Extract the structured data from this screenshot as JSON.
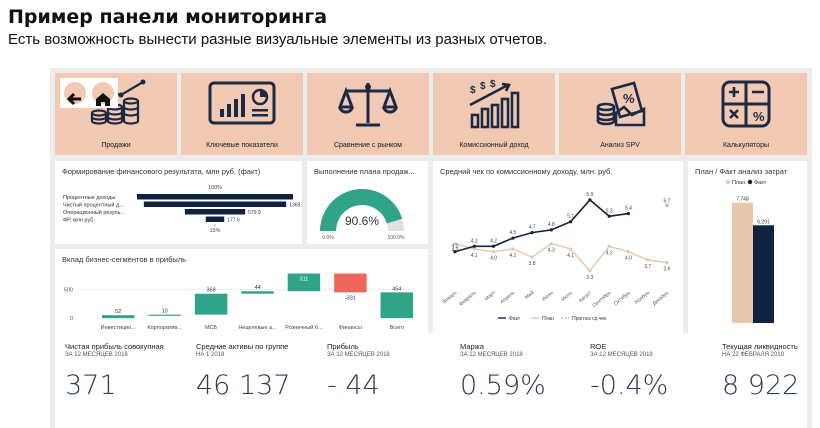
{
  "header": {
    "title": "Пример панели мониторинга",
    "subtitle": "Есть возможность вынести разные визуальные элементы из разных отчетов."
  },
  "nav": {
    "back_icon": "back-arrow-icon",
    "home_icon": "home-icon"
  },
  "tiles": [
    {
      "label": "Продажи",
      "icon": "sales-coins-icon"
    },
    {
      "label": "Ключевые показатели",
      "icon": "kpi-monitor-icon"
    },
    {
      "label": "Сравнение с рынком",
      "icon": "scales-icon"
    },
    {
      "label": "Комиссионный доход",
      "icon": "commission-chart-icon"
    },
    {
      "label": "Анализ SPV",
      "icon": "spv-percent-icon"
    },
    {
      "label": "Калькуляторы",
      "icon": "calculator-icon"
    }
  ],
  "colors": {
    "tile_bg": "#f2c9b3",
    "navy": "#0f2340",
    "teal": "#2fa489",
    "beige": "#e6c6ac",
    "red": "#f0675a",
    "value_text": "#2b3c55"
  },
  "chart_data": [
    {
      "type": "bar",
      "title": "Формирование финансового результата, млн руб. (факт)",
      "categories": [
        "Процентные доходы",
        "Чистый процентный д...",
        "Операционный резуль...",
        "ФР, млн руб."
      ],
      "values": [
        1500,
        1369.3,
        579.9,
        177.6
      ],
      "data_labels": [
        "",
        "1369.3",
        "579.9",
        "177.6"
      ],
      "top_label": "100%",
      "bottom_label": "15%"
    },
    {
      "type": "gauge",
      "title": "Выполнение плана продаж...",
      "value": 90.6,
      "display_value": "90.6%",
      "min_label": "0.0%",
      "max_label": "100.0%"
    },
    {
      "type": "line",
      "title": "Средний чек по комиссионному доходу, млн. руб.",
      "x": [
        "Январь",
        "Февраль",
        "Март",
        "Апрель",
        "Май",
        "Июнь",
        "Июль",
        "Август",
        "Сентябрь",
        "Октябрь",
        "Ноябрь",
        "Декабрь"
      ],
      "series": [
        {
          "name": "Факт",
          "values": [
            4.0,
            4.2,
            4.2,
            4.5,
            4.7,
            4.8,
            5.1,
            5.9,
            5.3,
            5.4,
            null,
            null
          ]
        },
        {
          "name": "План",
          "values": [
            4.3,
            4.1,
            4.0,
            4.1,
            3.8,
            4.3,
            4.1,
            3.3,
            4.2,
            4.0,
            3.7,
            3.6
          ]
        },
        {
          "name": "Прогноз ср.чек",
          "values": [
            null,
            null,
            null,
            null,
            null,
            null,
            null,
            null,
            null,
            null,
            null,
            5.7
          ]
        }
      ],
      "ylim": [
        3.0,
        6.3
      ]
    },
    {
      "type": "bar",
      "title": "План / Факт анализ затрат",
      "categories": [
        "План",
        "Факт"
      ],
      "series": [
        {
          "name": "План",
          "values": [
            7.748
          ]
        },
        {
          "name": "Факт",
          "values": [
            6.291
          ]
        }
      ],
      "data_labels": [
        "7.748",
        "6.291"
      ],
      "ylim": [
        0,
        8.5
      ],
      "legend": "top"
    },
    {
      "type": "waterfall",
      "title": "Вклад бизнес-сегментов в прибыль",
      "categories": [
        "Инвестицио...",
        "Корпоратив...",
        "МСБ",
        "Нецелевые а...",
        "Розничный б...",
        "Финансы",
        "Всего"
      ],
      "values": [
        52,
        10,
        368,
        44,
        311,
        -331,
        454
      ],
      "data_labels": [
        "52",
        "10",
        "368",
        "44",
        "311",
        "-331",
        "454"
      ],
      "y_ticks": [
        "500",
        "0"
      ],
      "ylim": [
        -50,
        900
      ]
    }
  ],
  "kpis": [
    {
      "title": "Чистая прибыль совокупная",
      "sub": "ЗА 12 МЕСЯЦЕВ 2018",
      "value": "371"
    },
    {
      "title": "Средние активы по группе",
      "sub": "НА 1 2018",
      "value": "46 137"
    },
    {
      "title": "Прибыль",
      "sub": "ЗА 12 МЕСЯЦЕВ 2018",
      "value": "- 44"
    },
    {
      "title": "Маржа",
      "sub": "ЗА 12 МЕСЯЦЕВ 2018",
      "value": "0.59%"
    },
    {
      "title": "ROE",
      "sub": "ЗА 12 МЕСЯЦЕВ 2018",
      "value": "-0.4%"
    },
    {
      "title": "Текущая ликвидность",
      "sub": "НА 22 ФЕВРАЛЯ 2019",
      "value": "8 922"
    }
  ]
}
